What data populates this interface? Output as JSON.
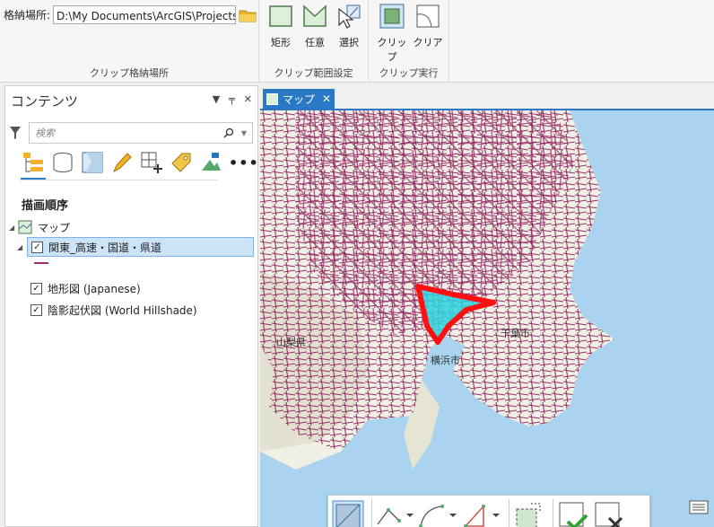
{
  "ribbon": {
    "storage": {
      "path_label": "格納場所:",
      "path_value": "D:\\My Documents\\ArcGIS\\Projects\\クリ",
      "group_label": "クリップ格納場所"
    },
    "range": {
      "buttons": [
        "矩形",
        "任意",
        "選択"
      ],
      "group_label": "クリップ範囲設定"
    },
    "execute": {
      "buttons": [
        "クリップ",
        "クリア"
      ],
      "group_label": "クリップ実行"
    }
  },
  "contents": {
    "title": "コンテンツ",
    "search_placeholder": "検索",
    "order_title": "描画順序",
    "map_name": "マップ",
    "layers": [
      {
        "name": "関東_高速・国道・県道",
        "checked": true
      },
      {
        "name": "地形図 (Japanese)",
        "checked": true
      },
      {
        "name": "陰影起伏図 (World Hillshade)",
        "checked": true
      }
    ],
    "icons": [
      "list-by-drawing-order-icon",
      "list-by-source-icon",
      "list-by-selection-icon",
      "list-by-editing-icon",
      "list-by-snapping-icon",
      "list-by-labeling-icon",
      "list-by-perspective-imagery-icon",
      "more-icon"
    ]
  },
  "mapview": {
    "tab_label": "マップ",
    "labels": {
      "yamanashi": "山梨県",
      "yokohama": "横浜市",
      "chiba": "千葉市"
    }
  },
  "colors": {
    "roads": "#8b1a5a",
    "clip_outline": "#ff1010",
    "clip_fill": "#2ed6e0",
    "water": "#a9d3ee",
    "land": "#f1f0e4",
    "accent": "#2b78c6"
  }
}
